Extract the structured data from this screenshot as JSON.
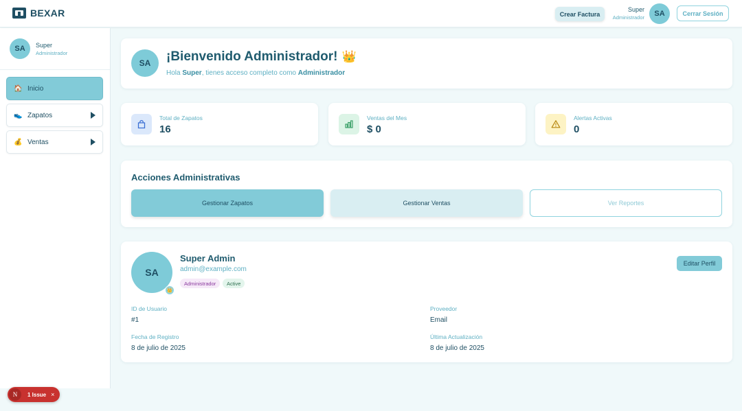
{
  "header": {
    "brand": "BEXAR",
    "create_invoice": "Crear Factura",
    "user_name": "Super",
    "user_role": "Administrador",
    "avatar_initials": "SA",
    "logout": "Cerrar Sesión"
  },
  "sidebar": {
    "user_name": "Super",
    "user_role": "Administrador",
    "avatar_initials": "SA",
    "items": [
      {
        "label": "Inicio",
        "icon": "home-icon",
        "active": true,
        "has_submenu": false
      },
      {
        "label": "Zapatos",
        "icon": "shoe-icon",
        "active": false,
        "has_submenu": true
      },
      {
        "label": "Ventas",
        "icon": "money-bag-icon",
        "active": false,
        "has_submenu": true
      }
    ]
  },
  "welcome": {
    "avatar_initials": "SA",
    "title": "¡Bienvenido Administrador!",
    "greeting_prefix": "Hola ",
    "greeting_name": "Super",
    "greeting_middle": ", tienes acceso completo como ",
    "greeting_role": "Administrador"
  },
  "stats": [
    {
      "label": "Total de Zapatos",
      "value": "16",
      "icon": "bag-icon",
      "color": "#dbe8fb"
    },
    {
      "label": "Ventas del Mes",
      "value": "$ 0",
      "icon": "chart-icon",
      "color": "#dcf4e6"
    },
    {
      "label": "Alertas Activas",
      "value": "0",
      "icon": "warning-icon",
      "color": "#fdf3c4"
    }
  ],
  "actions": {
    "title": "Acciones Administrativas",
    "buttons": [
      "Gestionar Zapatos",
      "Gestionar Ventas",
      "Ver Reportes"
    ]
  },
  "profile": {
    "avatar_initials": "SA",
    "name": "Super Admin",
    "email": "admin@example.com",
    "role_tag": "Administrador",
    "status_tag": "Active",
    "edit_button": "Editar Perfil",
    "fields": [
      {
        "label": "ID de Usuario",
        "value": "#1"
      },
      {
        "label": "Proveedor",
        "value": "Email"
      },
      {
        "label": "Fecha de Registro",
        "value": "8 de julio de 2025"
      },
      {
        "label": "Última Actualización",
        "value": "8 de julio de 2025"
      }
    ]
  },
  "issue_badge": {
    "letter": "N",
    "text": "1 Issue",
    "close": "×"
  }
}
